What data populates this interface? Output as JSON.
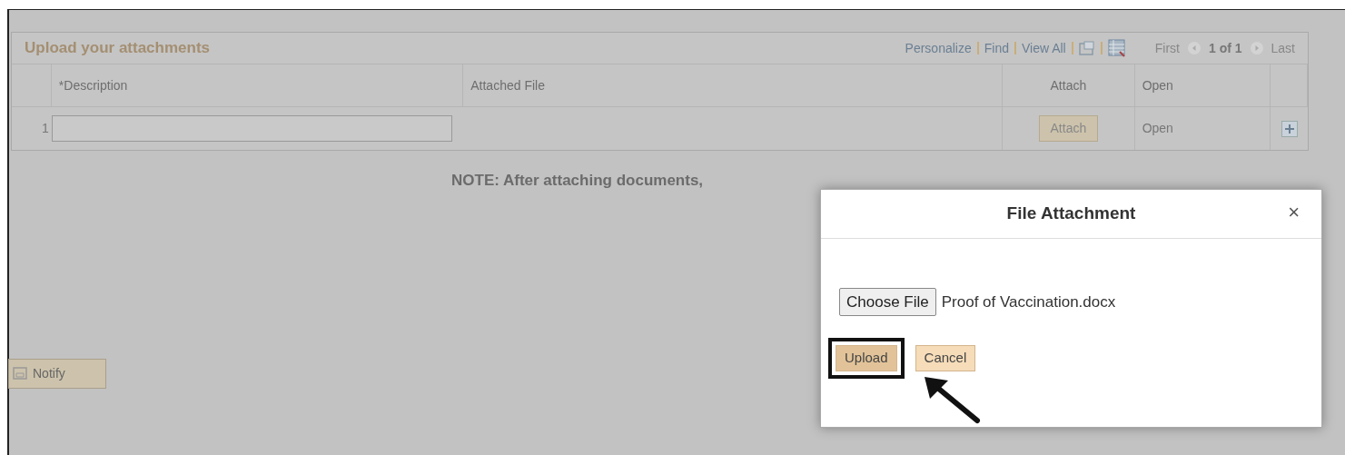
{
  "grid": {
    "title": "Upload your attachments",
    "links": [
      "Personalize",
      "Find",
      "View All"
    ],
    "pager": {
      "first": "First",
      "position": "1 of 1",
      "last": "Last"
    },
    "columns": [
      "*Description",
      "Attached File",
      "Attach",
      "Open"
    ],
    "rows": [
      {
        "number": "1",
        "attach": "Attach",
        "open": "Open"
      }
    ]
  },
  "note": "NOTE: After attaching documents,",
  "notify_button": "Notify",
  "dialog": {
    "title": "File Attachment",
    "close": "×",
    "choose_button": "Choose File",
    "file_name": "Proof of Vaccination.docx",
    "buttons": [
      {
        "label": "Upload",
        "highlighted": true
      },
      {
        "label": "Cancel",
        "highlighted": false
      }
    ]
  }
}
